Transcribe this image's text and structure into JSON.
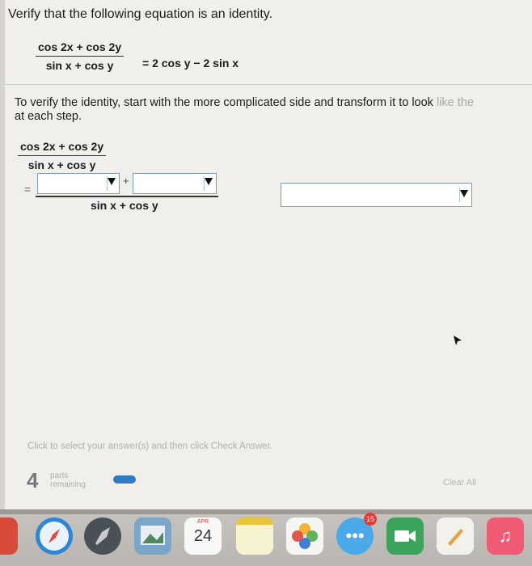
{
  "question": {
    "title": "Verify that the following equation is an identity.",
    "equation": {
      "numerator": "cos 2x + cos 2y",
      "denominator": "sin x + cos y",
      "rhs": "= 2 cos y − 2 sin x"
    }
  },
  "instruction": {
    "main": "To verify the identity, start with the more complicated side and transform it to look ",
    "faded": "like the",
    "line2": "at each step."
  },
  "step": {
    "numerator": "cos 2x + cos 2y",
    "denominator": "sin x + cos y",
    "equals": "=",
    "plus": "+",
    "work_denominator": "sin x + cos y"
  },
  "footer": {
    "status": "Click to select your answer(s) and then click Check Answer.",
    "parts_count": "4",
    "parts_label_1": "parts",
    "parts_label_2": "remaining",
    "clear_all": "Clear All",
    "progress_fraction": 0.25
  },
  "dock": {
    "calendar_month": "APR",
    "calendar_day": "24",
    "messages_badge": "15",
    "icons": [
      "maps-icon",
      "safari-icon",
      "launchpad-icon",
      "preview-icon",
      "calendar-icon",
      "notes-icon",
      "photos-icon",
      "messages-icon",
      "facetime-icon",
      "pages-icon",
      "music-icon"
    ]
  },
  "colors": {
    "background": "#f1efeb",
    "select_border": "#7f9bb5",
    "progress": "#2f7bc4"
  }
}
